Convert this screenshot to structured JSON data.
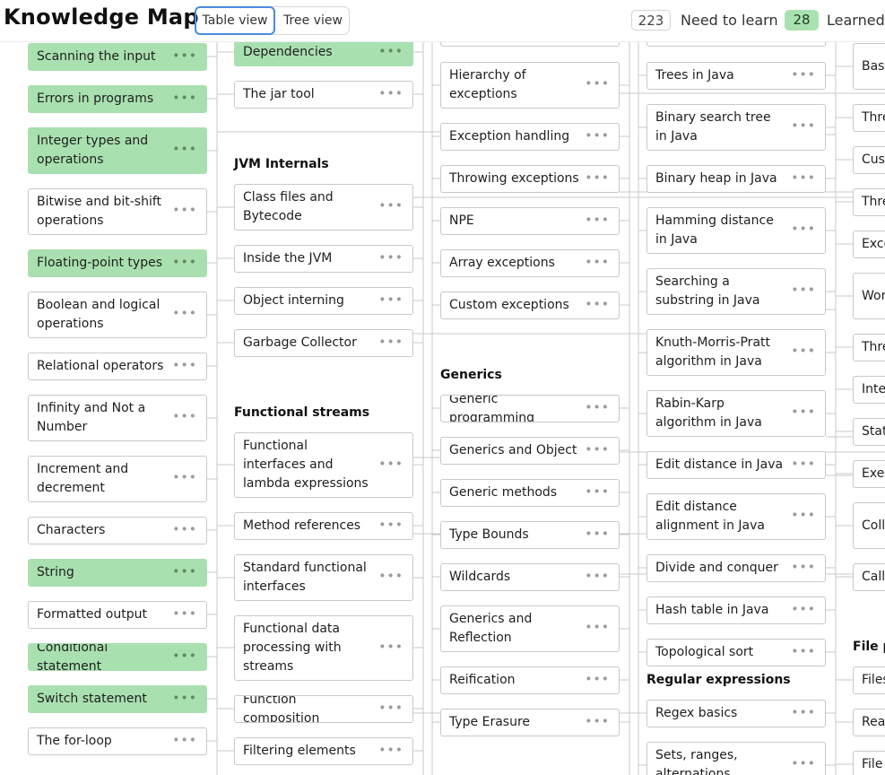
{
  "header": {
    "title": "Knowledge Map",
    "view_toggle": {
      "table_label": "Table view",
      "tree_label": "Tree view",
      "active": "table"
    },
    "need_to_learn": {
      "count": "223",
      "label": "Need to learn"
    },
    "learned": {
      "count": "28",
      "label": "Learned"
    }
  },
  "colors": {
    "learned_bg": "#a9e0b0",
    "accent_blue": "#4a8bdc",
    "learned_badge": "#a9e2b1"
  },
  "sections": {
    "jvm_internals": "JVM Internals",
    "functional_streams": "Functional streams",
    "generics": "Generics",
    "regular_expressions": "Regular expressions",
    "file_partial": "File p"
  },
  "columns": {
    "col1": [
      {
        "label": "Scanning the input",
        "learned": true
      },
      {
        "label": "Errors in programs",
        "learned": true
      },
      {
        "label": "Integer types and operations",
        "learned": true
      },
      {
        "label": "Bitwise and bit-shift operations",
        "learned": false
      },
      {
        "label": "Floating-point types",
        "learned": true
      },
      {
        "label": "Boolean and logical operations",
        "learned": false
      },
      {
        "label": "Relational operators",
        "learned": false
      },
      {
        "label": "Infinity and Not a Number",
        "learned": false
      },
      {
        "label": "Increment and decrement",
        "learned": false
      },
      {
        "label": "Characters",
        "learned": false
      },
      {
        "label": "String",
        "learned": true
      },
      {
        "label": "Formatted output",
        "learned": false
      },
      {
        "label": "Conditional statement",
        "learned": true
      },
      {
        "label": "Switch statement",
        "learned": true
      },
      {
        "label": "The for-loop",
        "learned": false
      }
    ],
    "col2": [
      {
        "label": "Dependencies",
        "learned": true
      },
      {
        "label": "The jar tool",
        "learned": false
      },
      {
        "label": "Class files and Bytecode",
        "learned": false
      },
      {
        "label": "Inside the JVM",
        "learned": false
      },
      {
        "label": "Object interning",
        "learned": false
      },
      {
        "label": "Garbage Collector",
        "learned": false
      },
      {
        "label": "Functional interfaces and lambda expressions",
        "learned": false
      },
      {
        "label": "Method references",
        "learned": false
      },
      {
        "label": "Standard functional interfaces",
        "learned": false
      },
      {
        "label": "Functional data processing with streams",
        "learned": false
      },
      {
        "label": "Function composition",
        "learned": false
      },
      {
        "label": "Filtering elements",
        "learned": false
      }
    ],
    "col3": [
      {
        "label": "Hierarchy of exceptions",
        "learned": false
      },
      {
        "label": "Exception handling",
        "learned": false
      },
      {
        "label": "Throwing exceptions",
        "learned": false
      },
      {
        "label": "NPE",
        "learned": false
      },
      {
        "label": "Array exceptions",
        "learned": false
      },
      {
        "label": "Custom exceptions",
        "learned": false
      },
      {
        "label": "Generic programming",
        "learned": false
      },
      {
        "label": "Generics and Object",
        "learned": false
      },
      {
        "label": "Generic methods",
        "learned": false
      },
      {
        "label": "Type Bounds",
        "learned": false
      },
      {
        "label": "Wildcards",
        "learned": false
      },
      {
        "label": "Generics and Reflection",
        "learned": false
      },
      {
        "label": "Reification",
        "learned": false
      },
      {
        "label": "Type Erasure",
        "learned": false
      }
    ],
    "col4": [
      {
        "label": "Trees in Java",
        "learned": false
      },
      {
        "label": "Binary search tree in Java",
        "learned": false
      },
      {
        "label": "Binary heap in Java",
        "learned": false
      },
      {
        "label": "Hamming distance in Java",
        "learned": false
      },
      {
        "label": "Searching a substring in Java",
        "learned": false
      },
      {
        "label": "Knuth-Morris-Pratt algorithm in Java",
        "learned": false
      },
      {
        "label": "Rabin-Karp algorithm in Java",
        "learned": false
      },
      {
        "label": "Edit distance in Java",
        "learned": false
      },
      {
        "label": "Edit distance alignment in Java",
        "learned": false
      },
      {
        "label": "Divide and conquer",
        "learned": false
      },
      {
        "label": "Hash table in Java",
        "learned": false
      },
      {
        "label": "Topological sort",
        "learned": false
      },
      {
        "label": "Regex basics",
        "learned": false
      },
      {
        "label": "Sets, ranges, alternations",
        "learned": false
      }
    ],
    "col5": [
      {
        "label": "Basi mult",
        "learned": false
      },
      {
        "label": "Thre",
        "learned": false
      },
      {
        "label": "Cust",
        "learned": false
      },
      {
        "label": "Thre",
        "learned": false
      },
      {
        "label": "Exce",
        "learned": false
      },
      {
        "label": "Work data",
        "learned": false
      },
      {
        "label": "Thre",
        "learned": false
      },
      {
        "label": "Inter",
        "learned": false
      },
      {
        "label": "Stat",
        "learned": false
      },
      {
        "label": "Exec",
        "learned": false
      },
      {
        "label": "Colle safe",
        "learned": false
      },
      {
        "label": "Calla",
        "learned": false
      },
      {
        "label": "Files",
        "learned": false
      },
      {
        "label": "Read",
        "learned": false
      },
      {
        "label": "File",
        "learned": false
      }
    ]
  },
  "more_icon": "more-horizontal-icon"
}
